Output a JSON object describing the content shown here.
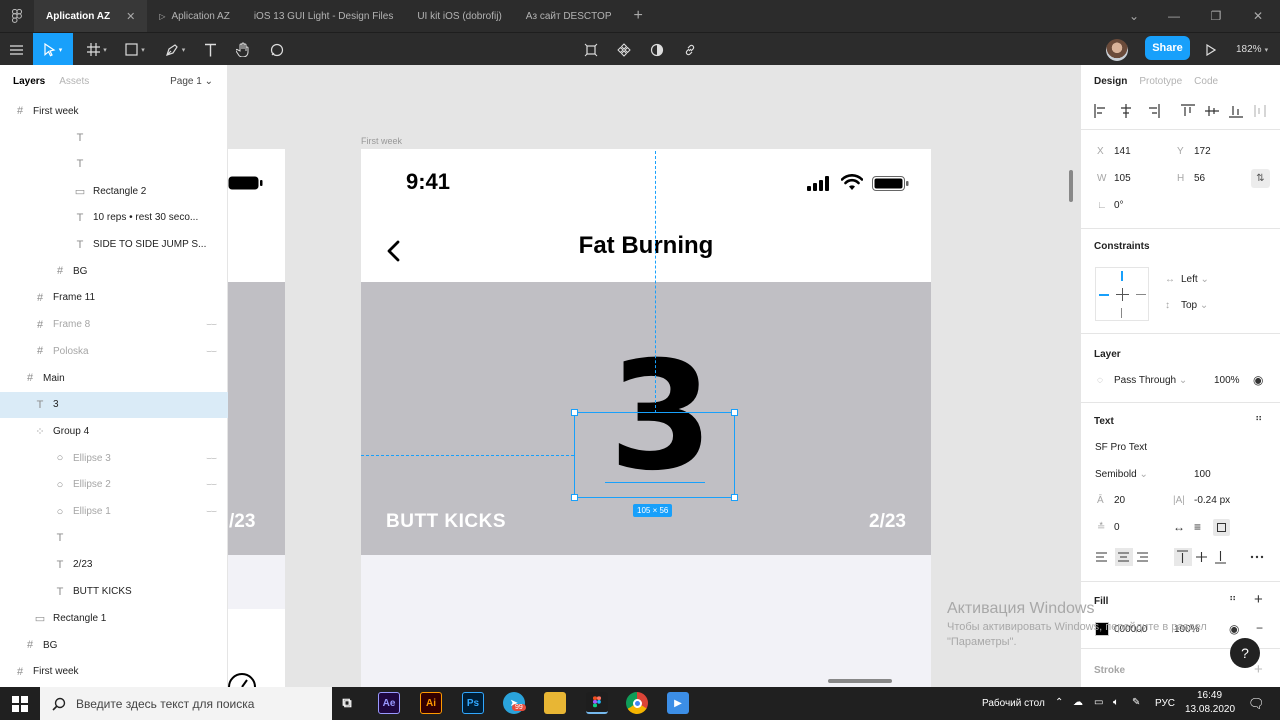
{
  "tabs": [
    {
      "label": "Aplication AZ",
      "active": true
    },
    {
      "label": "Aplication AZ",
      "active": false
    },
    {
      "label": "iOS 13 GUI Light - Design Files",
      "active": false
    },
    {
      "label": "UI kit iOS (dobrofij)",
      "active": false
    },
    {
      "label": "Аз сайт DESCTOP",
      "active": false
    }
  ],
  "toolbar": {
    "share": "Share",
    "zoom": "182%"
  },
  "left_panel": {
    "tab_layers": "Layers",
    "tab_assets": "Assets",
    "page": "Page 1",
    "layers": [
      {
        "label": "First week",
        "icon": "frame-icon",
        "indent": 0,
        "dim": false
      },
      {
        "label": "",
        "icon": "text-icon",
        "indent": 3,
        "dim": false
      },
      {
        "label": "",
        "icon": "text-icon",
        "indent": 3,
        "dim": false
      },
      {
        "label": "Rectangle 2",
        "icon": "rectangle-icon",
        "indent": 3,
        "dim": false
      },
      {
        "label": "10 reps • rest 30 seco...",
        "icon": "text-icon",
        "indent": 3,
        "dim": false
      },
      {
        "label": "SIDE TO SIDE JUMP S...",
        "icon": "text-icon",
        "indent": 3,
        "dim": false
      },
      {
        "label": "BG",
        "icon": "frame-icon",
        "indent": 2,
        "dim": false
      },
      {
        "label": "Frame 11",
        "icon": "frame-icon",
        "indent": 1,
        "dim": false
      },
      {
        "label": "Frame 8",
        "icon": "frame-icon",
        "indent": 1,
        "dim": true
      },
      {
        "label": "Poloska",
        "icon": "frame-icon",
        "indent": 1,
        "dim": true
      },
      {
        "label": "Main",
        "icon": "frame-icon",
        "indent": 0.5,
        "dim": false
      },
      {
        "label": "3",
        "icon": "text-icon",
        "indent": 1,
        "dim": false,
        "selected": true
      },
      {
        "label": "Group 4",
        "icon": "group-icon",
        "indent": 1,
        "dim": false
      },
      {
        "label": "Ellipse 3",
        "icon": "ellipse-icon",
        "indent": 2,
        "dim": true
      },
      {
        "label": "Ellipse 2",
        "icon": "ellipse-icon",
        "indent": 2,
        "dim": true
      },
      {
        "label": "Ellipse 1",
        "icon": "ellipse-icon",
        "indent": 2,
        "dim": true
      },
      {
        "label": "",
        "icon": "text-icon",
        "indent": 2,
        "dim": false
      },
      {
        "label": "2/23",
        "icon": "text-icon",
        "indent": 2,
        "dim": false
      },
      {
        "label": "BUTT KICKS",
        "icon": "text-icon",
        "indent": 2,
        "dim": false
      },
      {
        "label": "Rectangle 1",
        "icon": "rectangle-icon",
        "indent": 1,
        "dim": false
      },
      {
        "label": "BG",
        "icon": "frame-icon",
        "indent": 0.5,
        "dim": false
      },
      {
        "label": "First week",
        "icon": "frame-icon",
        "indent": 0,
        "dim": false
      }
    ]
  },
  "canvas": {
    "frame_label": "First week",
    "time": "9:41",
    "title": "Fat Burning",
    "big_number": "3",
    "exercise": "BUTT KICKS",
    "count": "2/23",
    "left_count": "/23",
    "size_tag": "105 × 56"
  },
  "right_panel": {
    "tab_design": "Design",
    "tab_prototype": "Prototype",
    "tab_code": "Code",
    "x_label": "X",
    "x": "141",
    "y_label": "Y",
    "y": "172",
    "w_label": "W",
    "w": "105",
    "h_label": "H",
    "h": "56",
    "rotation": "0°",
    "constraints_title": "Constraints",
    "constraint_h": "Left",
    "constraint_v": "Top",
    "layer_title": "Layer",
    "blend": "Pass Through",
    "opacity": "100%",
    "text_title": "Text",
    "font": "SF Pro Text",
    "weight": "Semibold",
    "size": "100",
    "line_height": "20",
    "letter_spacing": "-0.24 px",
    "paragraph": "0",
    "fill_title": "Fill",
    "fill_hex": "000000",
    "fill_opacity": "100%",
    "stroke_title": "Stroke"
  },
  "watermark": {
    "title": "Активация Windows",
    "line1": "Чтобы активировать Windows, перейдите в раздел",
    "line2": "\"Параметры\"."
  },
  "taskbar": {
    "search": "Введите здесь текст для поиска",
    "desktop": "Рабочий стол",
    "lang": "РУС",
    "time": "16:49",
    "date": "13.08.2020",
    "badge": "99"
  },
  "colors": {
    "accent": "#18a0fb",
    "hero_bg": "#c0bfc4",
    "chrome": "#2c2c2c"
  }
}
